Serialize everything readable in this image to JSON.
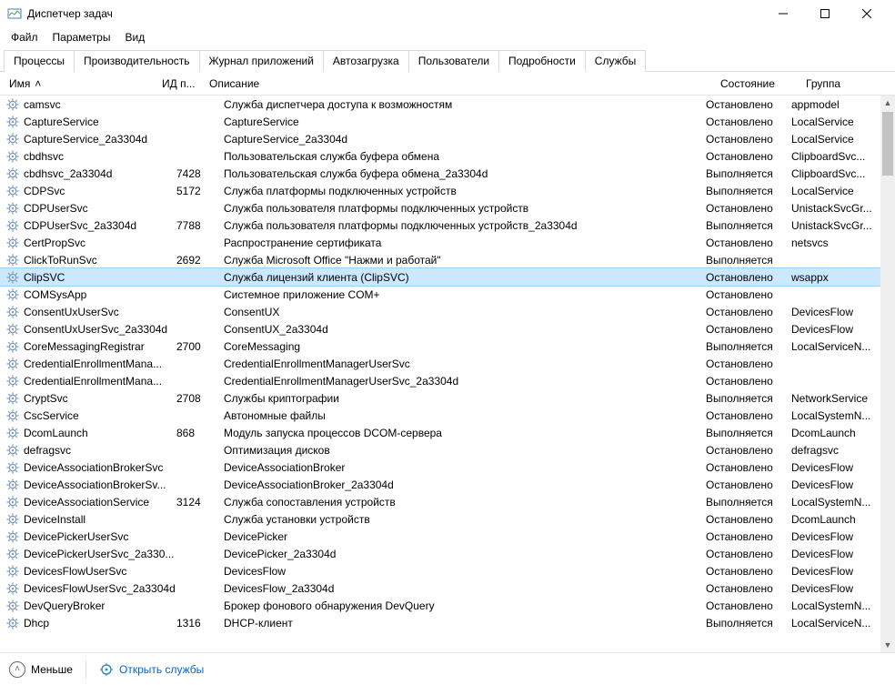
{
  "window": {
    "title": "Диспетчер задач"
  },
  "menu": {
    "file": "Файл",
    "options": "Параметры",
    "view": "Вид"
  },
  "tabs": {
    "processes": "Процессы",
    "performance": "Производительность",
    "apphistory": "Журнал приложений",
    "startup": "Автозагрузка",
    "users": "Пользователи",
    "details": "Подробности",
    "services": "Службы"
  },
  "columns": {
    "name": "Имя",
    "pid": "ИД п...",
    "description": "Описание",
    "state": "Состояние",
    "group": "Группа"
  },
  "states": {
    "stopped": "Остановлено",
    "running": "Выполняется"
  },
  "rows": [
    {
      "name": "camsvc",
      "pid": "",
      "desc": "Служба диспетчера доступа к возможностям",
      "state": "stopped",
      "group": "appmodel"
    },
    {
      "name": "CaptureService",
      "pid": "",
      "desc": "CaptureService",
      "state": "stopped",
      "group": "LocalService"
    },
    {
      "name": "CaptureService_2a3304d",
      "pid": "",
      "desc": "CaptureService_2a3304d",
      "state": "stopped",
      "group": "LocalService"
    },
    {
      "name": "cbdhsvc",
      "pid": "",
      "desc": "Пользовательская служба буфера обмена",
      "state": "stopped",
      "group": "ClipboardSvc..."
    },
    {
      "name": "cbdhsvc_2a3304d",
      "pid": "7428",
      "desc": "Пользовательская служба буфера обмена_2a3304d",
      "state": "running",
      "group": "ClipboardSvc..."
    },
    {
      "name": "CDPSvc",
      "pid": "5172",
      "desc": "Служба платформы подключенных устройств",
      "state": "running",
      "group": "LocalService"
    },
    {
      "name": "CDPUserSvc",
      "pid": "",
      "desc": "Служба пользователя платформы подключенных устройств",
      "state": "stopped",
      "group": "UnistackSvcGr..."
    },
    {
      "name": "CDPUserSvc_2a3304d",
      "pid": "7788",
      "desc": "Служба пользователя платформы подключенных устройств_2a3304d",
      "state": "running",
      "group": "UnistackSvcGr..."
    },
    {
      "name": "CertPropSvc",
      "pid": "",
      "desc": "Распространение сертификата",
      "state": "stopped",
      "group": "netsvcs"
    },
    {
      "name": "ClickToRunSvc",
      "pid": "2692",
      "desc": "Служба Microsoft Office \"Нажми и работай\"",
      "state": "running",
      "group": ""
    },
    {
      "name": "ClipSVC",
      "pid": "",
      "desc": "Служба лицензий клиента (ClipSVC)",
      "state": "stopped",
      "group": "wsappx",
      "selected": true
    },
    {
      "name": "COMSysApp",
      "pid": "",
      "desc": "Системное приложение COM+",
      "state": "stopped",
      "group": ""
    },
    {
      "name": "ConsentUxUserSvc",
      "pid": "",
      "desc": "ConsentUX",
      "state": "stopped",
      "group": "DevicesFlow"
    },
    {
      "name": "ConsentUxUserSvc_2a3304d",
      "pid": "",
      "desc": "ConsentUX_2a3304d",
      "state": "stopped",
      "group": "DevicesFlow"
    },
    {
      "name": "CoreMessagingRegistrar",
      "pid": "2700",
      "desc": "CoreMessaging",
      "state": "running",
      "group": "LocalServiceN..."
    },
    {
      "name": "CredentialEnrollmentMana...",
      "pid": "",
      "desc": "CredentialEnrollmentManagerUserSvc",
      "state": "stopped",
      "group": ""
    },
    {
      "name": "CredentialEnrollmentMana...",
      "pid": "",
      "desc": "CredentialEnrollmentManagerUserSvc_2a3304d",
      "state": "stopped",
      "group": ""
    },
    {
      "name": "CryptSvc",
      "pid": "2708",
      "desc": "Службы криптографии",
      "state": "running",
      "group": "NetworkService"
    },
    {
      "name": "CscService",
      "pid": "",
      "desc": "Автономные файлы",
      "state": "stopped",
      "group": "LocalSystemN..."
    },
    {
      "name": "DcomLaunch",
      "pid": "868",
      "desc": "Модуль запуска процессов DCOM-сервера",
      "state": "running",
      "group": "DcomLaunch"
    },
    {
      "name": "defragsvc",
      "pid": "",
      "desc": "Оптимизация дисков",
      "state": "stopped",
      "group": "defragsvc"
    },
    {
      "name": "DeviceAssociationBrokerSvc",
      "pid": "",
      "desc": "DeviceAssociationBroker",
      "state": "stopped",
      "group": "DevicesFlow"
    },
    {
      "name": "DeviceAssociationBrokerSv...",
      "pid": "",
      "desc": "DeviceAssociationBroker_2a3304d",
      "state": "stopped",
      "group": "DevicesFlow"
    },
    {
      "name": "DeviceAssociationService",
      "pid": "3124",
      "desc": "Служба сопоставления устройств",
      "state": "running",
      "group": "LocalSystemN..."
    },
    {
      "name": "DeviceInstall",
      "pid": "",
      "desc": "Служба установки устройств",
      "state": "stopped",
      "group": "DcomLaunch"
    },
    {
      "name": "DevicePickerUserSvc",
      "pid": "",
      "desc": "DevicePicker",
      "state": "stopped",
      "group": "DevicesFlow"
    },
    {
      "name": "DevicePickerUserSvc_2a330...",
      "pid": "",
      "desc": "DevicePicker_2a3304d",
      "state": "stopped",
      "group": "DevicesFlow"
    },
    {
      "name": "DevicesFlowUserSvc",
      "pid": "",
      "desc": "DevicesFlow",
      "state": "stopped",
      "group": "DevicesFlow"
    },
    {
      "name": "DevicesFlowUserSvc_2a3304d",
      "pid": "",
      "desc": "DevicesFlow_2a3304d",
      "state": "stopped",
      "group": "DevicesFlow"
    },
    {
      "name": "DevQueryBroker",
      "pid": "",
      "desc": "Брокер фонового обнаружения DevQuery",
      "state": "stopped",
      "group": "LocalSystemN..."
    },
    {
      "name": "Dhcp",
      "pid": "1316",
      "desc": "DHCP-клиент",
      "state": "running",
      "group": "LocalServiceN..."
    }
  ],
  "status": {
    "fewer": "Меньше",
    "open_services": "Открыть службы"
  }
}
